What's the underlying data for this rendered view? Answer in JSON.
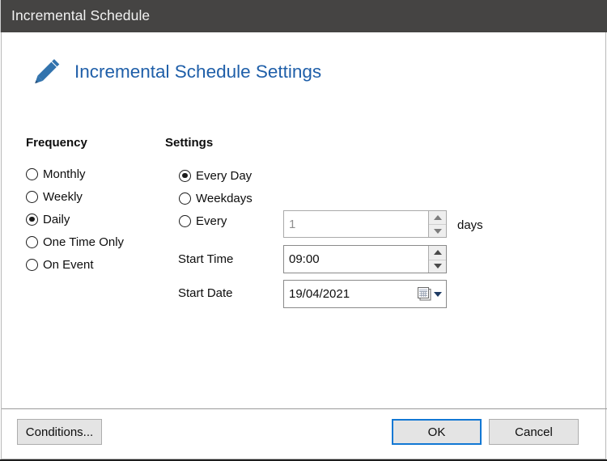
{
  "window": {
    "title": "Incremental Schedule"
  },
  "header": {
    "title": "Incremental Schedule Settings",
    "icon": "pencil-icon",
    "accent_color": "#1f5fa9"
  },
  "frequency": {
    "heading": "Frequency",
    "selected": "Daily",
    "options": [
      {
        "label": "Monthly",
        "checked": false
      },
      {
        "label": "Weekly",
        "checked": false
      },
      {
        "label": "Daily",
        "checked": true
      },
      {
        "label": "One Time Only",
        "checked": false
      },
      {
        "label": "On Event",
        "checked": false
      }
    ]
  },
  "settings": {
    "heading": "Settings",
    "selected": "Every Day",
    "options": [
      {
        "label": "Every Day",
        "checked": true
      },
      {
        "label": "Weekdays",
        "checked": false
      },
      {
        "label": "Every",
        "checked": false
      }
    ],
    "every_interval": {
      "value": "1",
      "unit_label": "days",
      "disabled": true,
      "spinner_up_icon": "triangle-up-icon",
      "spinner_down_icon": "triangle-down-icon"
    },
    "start_time": {
      "label": "Start Time",
      "value": "09:00",
      "spinner_up_icon": "triangle-up-icon",
      "spinner_down_icon": "triangle-down-icon"
    },
    "start_date": {
      "label": "Start Date",
      "value": "19/04/2021",
      "calendar_icon": "calendar-icon",
      "dropdown_icon": "chevron-down-icon"
    }
  },
  "footer": {
    "conditions_label": "Conditions...",
    "ok_label": "OK",
    "cancel_label": "Cancel",
    "focus_color": "#1278d4"
  },
  "colors": {
    "titlebar_bg": "#454443",
    "titlebar_text": "#f2f2f2",
    "dialog_bg": "#ffffff",
    "text": "#0d0d0d",
    "disabled_text": "#8f8f8f",
    "accent_blue": "#1f5fa9",
    "focus_blue": "#1278d4"
  }
}
